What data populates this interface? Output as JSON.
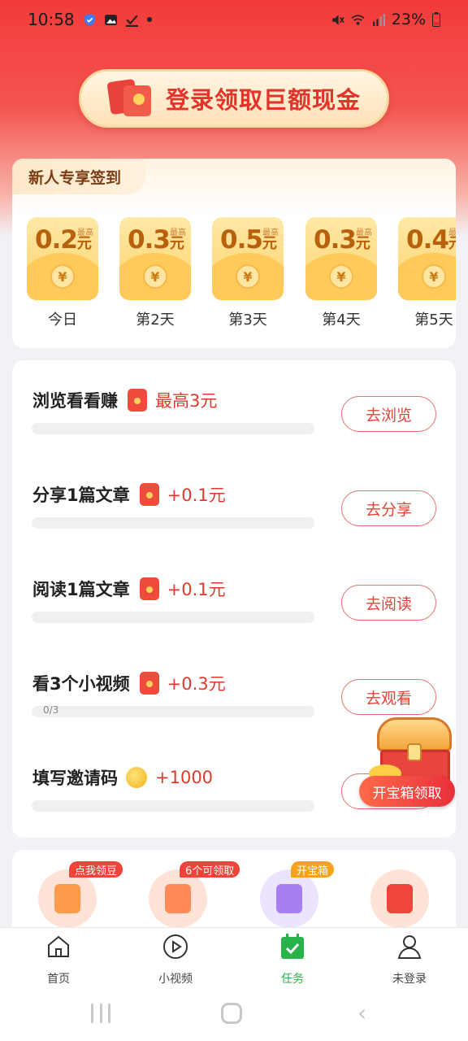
{
  "status_bar": {
    "time": "10:58",
    "battery": "23%",
    "icons": [
      "shield-icon",
      "image-icon",
      "check-icon",
      "dot-icon",
      "mute-icon",
      "wifi-icon",
      "signal-icon",
      "battery-icon"
    ]
  },
  "banner": {
    "text": "登录领取巨额现金"
  },
  "checkin": {
    "title": "新人专享签到",
    "max_label": "最高",
    "unit": "元",
    "days": [
      {
        "amount": "0.2",
        "label": "今日"
      },
      {
        "amount": "0.3",
        "label": "第2天"
      },
      {
        "amount": "0.5",
        "label": "第3天"
      },
      {
        "amount": "0.3",
        "label": "第4天"
      },
      {
        "amount": "0.4",
        "label": "第5天"
      }
    ],
    "yen": "¥"
  },
  "tasks": [
    {
      "title": "浏览看看赚",
      "reward": "最高3元",
      "icon": "red-packet-icon",
      "button": "去浏览",
      "progress": ""
    },
    {
      "title": "分享1篇文章",
      "reward": "+0.1元",
      "icon": "red-packet-icon",
      "button": "去分享",
      "progress": ""
    },
    {
      "title": "阅读1篇文章",
      "reward": "+0.1元",
      "icon": "red-packet-icon",
      "button": "去阅读",
      "progress": ""
    },
    {
      "title": "看3个小视频",
      "reward": "+0.3元",
      "icon": "red-packet-icon",
      "button": "去观看",
      "progress": "0/3"
    },
    {
      "title": "填写邀请码",
      "reward": "+1000",
      "icon": "coin-icon",
      "button": "",
      "progress": ""
    }
  ],
  "treasure": {
    "button": "开宝箱领取"
  },
  "shortcuts": [
    {
      "badge": "点我领豆",
      "color": "#ffe3d6",
      "inner": "#ff9a4a",
      "badge_color": "#f0443a"
    },
    {
      "badge": "6个可领取",
      "color": "#ffe3d6",
      "inner": "#ff8a5a",
      "badge_color": "#f0443a"
    },
    {
      "badge": "开宝箱",
      "color": "#ece4ff",
      "inner": "#a77ff0",
      "badge_color": "#f7a21b"
    },
    {
      "badge": "",
      "color": "#ffe3d6",
      "inner": "#f0453a",
      "badge_color": ""
    }
  ],
  "tabbar": {
    "items": [
      {
        "label": "首页",
        "icon": "home-icon"
      },
      {
        "label": "小视频",
        "icon": "play-icon"
      },
      {
        "label": "任务",
        "icon": "task-calendar-icon",
        "active": true
      },
      {
        "label": "未登录",
        "icon": "user-icon"
      }
    ]
  },
  "colors": {
    "accent": "#e03a2d",
    "active_tab": "#27b24a"
  }
}
